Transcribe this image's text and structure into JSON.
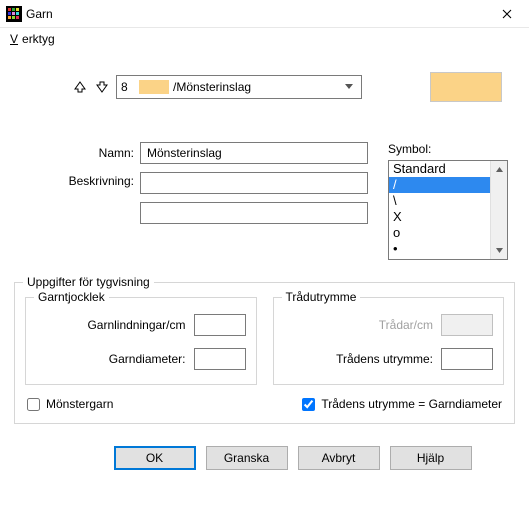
{
  "window": {
    "title": "Garn"
  },
  "menu": {
    "tools": "Verktyg"
  },
  "dropdown": {
    "num": "8",
    "label": "/Mönsterinslag"
  },
  "colors": {
    "yarn": "#fbd387"
  },
  "fields": {
    "name_label": "Namn:",
    "name_value": "Mönsterinslag",
    "desc_label": "Beskrivning:",
    "desc_value": "",
    "desc2_value": ""
  },
  "symbol": {
    "label": "Symbol:",
    "items": [
      "Standard",
      "/",
      "\\",
      "X",
      "o",
      "•"
    ],
    "selected_index": 1
  },
  "display": {
    "legend": "Uppgifter för tygvisning",
    "thickness": {
      "legend": "Garntjocklek",
      "wraps_label": "Garnlindningar/cm",
      "wraps_value": "",
      "diameter_label": "Garndiameter:",
      "diameter_value": ""
    },
    "space": {
      "legend": "Trådutrymme",
      "threads_label": "Trådar/cm",
      "threads_value": "",
      "threadspace_label": "Trådens utrymme:",
      "threadspace_value": ""
    }
  },
  "checks": {
    "pattern_label": "Mönstergarn",
    "pattern_checked": false,
    "equal_label": "Trådens utrymme = Garndiameter",
    "equal_checked": true
  },
  "buttons": {
    "ok": "OK",
    "preview": "Granska",
    "cancel": "Avbryt",
    "help": "Hjälp"
  }
}
